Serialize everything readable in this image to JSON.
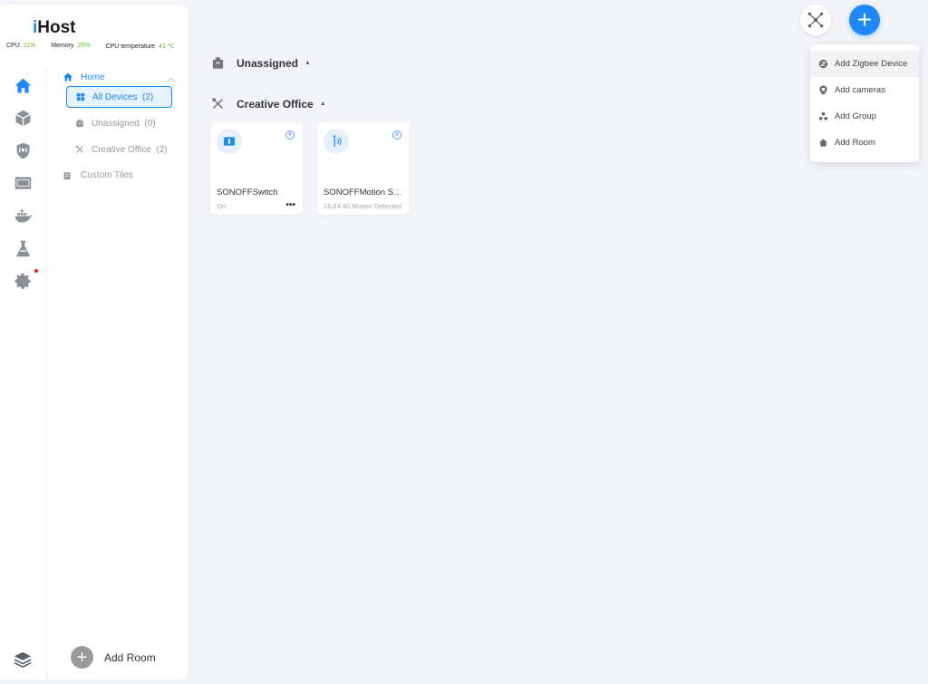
{
  "app": {
    "logo_prefix": "i",
    "logo_rest": "Host"
  },
  "stats": [
    {
      "label": "CPU",
      "value": "11%"
    },
    {
      "label": "Memory",
      "value": "25%"
    },
    {
      "label": "CPU temperature",
      "value": "41 ℃"
    }
  ],
  "rail": {
    "icons": [
      "home-icon",
      "cube-icon",
      "shield-icon",
      "monitor-icon",
      "docker-icon",
      "flask-icon",
      "gear-icon"
    ],
    "bottom_icon": "layers-icon"
  },
  "nav": {
    "home": "Home",
    "items": [
      {
        "label": "All Devices  (2)",
        "icon": "grid-icon"
      },
      {
        "label": "Unassigned  (0)",
        "icon": "box-icon"
      },
      {
        "label": "Creative Office  (2)",
        "icon": "tools-icon"
      }
    ],
    "custom_tiles": "Custom Tiles",
    "add_room": "Add Room"
  },
  "main": {
    "sections": [
      {
        "title": "Unassigned",
        "icon": "box-icon"
      },
      {
        "title": "Creative Office",
        "icon": "tools-icon"
      }
    ],
    "devices": [
      {
        "name": "SONOFFSwitch",
        "status": "On",
        "badge": "R",
        "icon": "switch-icon",
        "more": "•••"
      },
      {
        "name": "SONOFFMotion Sensor",
        "status": "15:24:40 Motion Detected",
        "badge": "R",
        "icon": "motion-icon"
      }
    ]
  },
  "dropdown": {
    "items": [
      {
        "label": "Add Zigbee Device",
        "icon": "zigbee-icon"
      },
      {
        "label": "Add cameras",
        "icon": "camera-icon"
      },
      {
        "label": "Add Group",
        "icon": "group-icon"
      },
      {
        "label": "Add Room",
        "icon": "room-icon"
      }
    ]
  },
  "colors": {
    "accent": "#1e88ff",
    "stat_value": "#52c41a",
    "dot": "#e02020"
  }
}
